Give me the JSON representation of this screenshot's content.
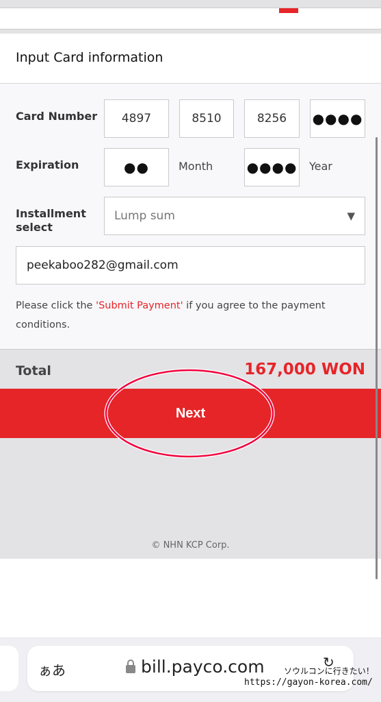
{
  "page": {
    "title": "Input Card information"
  },
  "form": {
    "card_number_label": "Card Number",
    "card_number": [
      "4897",
      "8510",
      "8256",
      "●●●●"
    ],
    "expiration_label": "Expiration",
    "month_value": "●●",
    "month_label": "Month",
    "year_value": "●●●●",
    "year_label": "Year",
    "installment_label": "Installment select",
    "installment_value": "Lump sum",
    "email_value": "peekaboo282@gmail.com",
    "notice_pre": "Please click the ",
    "notice_highlight": "'Submit Payment'",
    "notice_post": " if you agree to the payment conditions."
  },
  "total": {
    "label": "Total",
    "amount": "167,000 WON"
  },
  "next_button": "Next",
  "footer": {
    "copyright": "© NHN KCP Corp."
  },
  "browser": {
    "text_size": "ぁあ",
    "url": "bill.payco.com",
    "reload_icon": "reload-icon"
  },
  "watermark": {
    "line1": "ソウルコンに行きたい！",
    "line2": "https://gayon-korea.com/"
  },
  "colors": {
    "accent": "#e52528",
    "annotation": "#f0003c"
  }
}
